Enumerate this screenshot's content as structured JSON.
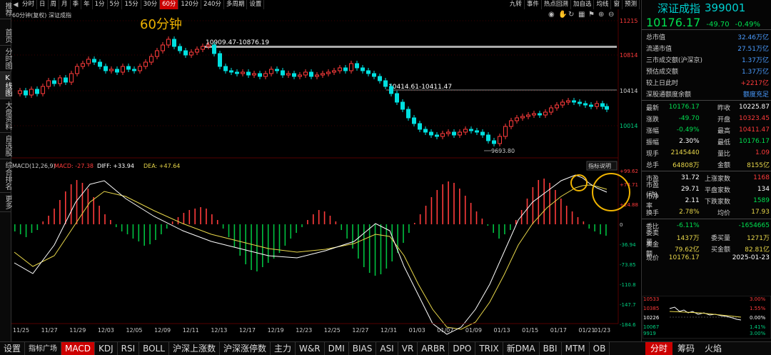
{
  "left_tabs": [
    "推荐",
    "首页",
    "分时图",
    "K线图",
    "大盘资料",
    "自选股",
    "综合排名",
    "更多"
  ],
  "toolbar": {
    "left": [
      "分时",
      "日",
      "周",
      "月",
      "季",
      "年",
      "1分",
      "5分",
      "15分",
      "30分",
      "60分",
      "120分",
      "240分",
      "多周期",
      "设置"
    ],
    "active": "60分",
    "right": [
      "九转",
      "事件",
      "热点回溯",
      "加自选",
      "均线",
      "窗",
      "预测"
    ]
  },
  "chart": {
    "legend_left": "60分钟(复权)",
    "legend_right": "深证成指",
    "big_label": "60分钟",
    "annot_high": "10909.47-10876.19",
    "annot_mid": "10414.61-10411.47",
    "annot_low": "9693.80",
    "price_ticks": [
      "11215",
      "10814",
      "10414",
      "10014"
    ],
    "macd_legend": {
      "name": "MACD(12,26,9)",
      "macd": "MACD: -27.38",
      "diff": "DIFF: +33.94",
      "dea": "DEA: +47.64"
    },
    "indicator_btn": "指标说明",
    "macd_ticks": [
      "+99.62",
      "+74.71",
      "+24.88",
      "0",
      "-36.94",
      "-73.85",
      "-110.8",
      "-147.7",
      "-184.6"
    ],
    "dates": [
      "11/25",
      "11/27",
      "11/29",
      "12/03",
      "12/05",
      "12/09",
      "12/11",
      "12/13",
      "12/17",
      "12/19",
      "12/23",
      "12/25",
      "12/27",
      "12/31",
      "01/03",
      "01/07",
      "01/09",
      "01/13",
      "01/15",
      "01/17",
      "01/21",
      "01/23"
    ],
    "colors": {
      "up": "#ff3b3b",
      "down": "#00e0e0",
      "diff": "#ffffff",
      "dea": "#e8d74a",
      "grid": "#3a0000",
      "highlight": "#f0b400"
    }
  },
  "right_panel": {
    "name": "深证成指",
    "code": "399001",
    "price": "10176.17",
    "change": "-49.70",
    "change_pct": "-0.49%",
    "rows_a": [
      {
        "k": "总市值",
        "v": "32.46万亿"
      },
      {
        "k": "流通市值",
        "v": "27.51万亿"
      },
      {
        "k": "三市成交额(沪深京)",
        "v": "1.37万亿"
      },
      {
        "k": "预估成交额",
        "v": "1.37万亿"
      },
      {
        "k": "较上日此时",
        "v": "+2217亿"
      },
      {
        "k": "深股通额度余额",
        "v": "额度充足"
      }
    ],
    "rows_b": [
      {
        "k1": "最新",
        "v1": "10176.17",
        "k2": "昨收",
        "v2": "10225.87"
      },
      {
        "k1": "涨跌",
        "v1": "-49.70",
        "k2": "开盘",
        "v2": "10323.45"
      },
      {
        "k1": "涨幅",
        "v1": "-0.49%",
        "k2": "最高",
        "v2": "10411.47"
      },
      {
        "k1": "振幅",
        "v1": "2.30%",
        "k2": "最低",
        "v2": "10176.17"
      },
      {
        "k1": "现手",
        "v1": "2145440",
        "k2": "量比",
        "v2": "1.09"
      },
      {
        "k1": "总手",
        "v1": "64808万",
        "k2": "金额",
        "v2": "8155亿"
      }
    ],
    "rows_c": [
      {
        "k1": "市盈",
        "v1": "31.72",
        "k2": "上涨家数",
        "v2": "1168"
      },
      {
        "k1": "市盈(动)",
        "v1": "29.71",
        "k2": "平盘家数",
        "v2": "134"
      },
      {
        "k1": "市净率",
        "v1": "2.11",
        "k2": "下跌家数",
        "v2": "1589"
      },
      {
        "k1": "换手",
        "v1": "2.78%",
        "k2": "均价",
        "v2": "17.93"
      }
    ],
    "rows_d": [
      {
        "k1": "委比",
        "v1": "-6.11%",
        "k2": "",
        "v2": "-1654665"
      },
      {
        "k1": "委卖量",
        "v1": "1437万",
        "k2": "委买量",
        "v2": "1271万"
      },
      {
        "k1": "卖金额",
        "v1": "79.62亿",
        "k2": "买金额",
        "v2": "82.81亿"
      },
      {
        "k1": "现价",
        "v1": "10176.17",
        "k2": "",
        "v2": "2025-01-23"
      }
    ],
    "mini_left": [
      "10533",
      "10385",
      "10226",
      "10067",
      "9919",
      "1291"
    ],
    "mini_right": [
      "3.00%",
      "1.55%",
      "0.00%",
      "1.41%",
      "3.00%"
    ]
  },
  "bottom_tabs": [
    "设置",
    "指标广场",
    "MACD",
    "KDJ",
    "RSI",
    "BOLL",
    "沪深上涨数",
    "沪深涨停数",
    "主力",
    "W&R",
    "DMI",
    "BIAS",
    "ASI",
    "VR",
    "ARBR",
    "DPO",
    "TRIX",
    "新DMA",
    "BBI",
    "MTM",
    "OB"
  ],
  "bottom_active": "MACD",
  "bottom_right": [
    "分时",
    "筹码",
    "火焰"
  ],
  "bottom_right_active": "分时"
}
